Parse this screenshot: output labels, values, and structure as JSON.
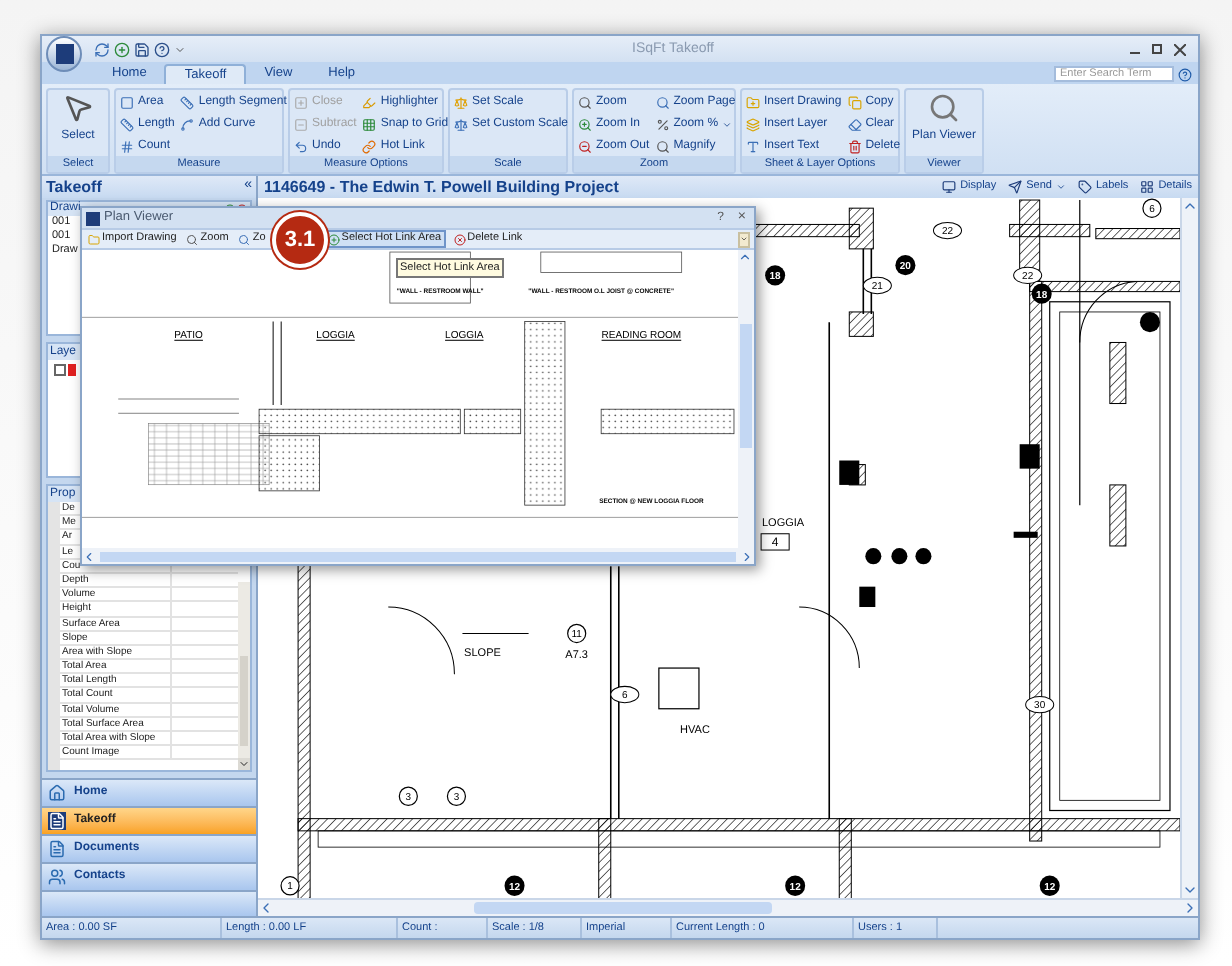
{
  "window": {
    "title": "ISqFt Takeoff"
  },
  "ribbon_tabs": [
    {
      "label": "Home",
      "selected": false
    },
    {
      "label": "Takeoff",
      "selected": true
    },
    {
      "label": "View",
      "selected": false
    },
    {
      "label": "Help",
      "selected": false
    }
  ],
  "search": {
    "placeholder": "Enter Search Term"
  },
  "ribbon_groups": [
    {
      "label": "Select",
      "kind": "large",
      "columns": [
        [
          {
            "label": "Select",
            "disabled": false
          }
        ]
      ]
    },
    {
      "label": "Measure",
      "kind": "small",
      "columns": [
        [
          {
            "label": "Area",
            "disabled": false
          },
          {
            "label": "Length",
            "disabled": false
          },
          {
            "label": "Count",
            "disabled": false
          }
        ],
        [
          {
            "label": "Length Segment",
            "disabled": false
          },
          {
            "label": "Add Curve",
            "disabled": false
          }
        ]
      ]
    },
    {
      "label": "Measure Options",
      "kind": "small",
      "columns": [
        [
          {
            "label": "Close",
            "disabled": true
          },
          {
            "label": "Subtract",
            "disabled": true
          },
          {
            "label": "Undo",
            "disabled": false
          }
        ],
        [
          {
            "label": "Highlighter",
            "disabled": false
          },
          {
            "label": "Snap to Grid",
            "disabled": false
          },
          {
            "label": "Hot Link",
            "disabled": false
          }
        ]
      ]
    },
    {
      "label": "Scale",
      "kind": "small",
      "columns": [
        [
          {
            "label": "Set Scale",
            "disabled": false
          },
          {
            "label": "Set Custom Scale",
            "disabled": false
          }
        ]
      ]
    },
    {
      "label": "Zoom",
      "kind": "small",
      "columns": [
        [
          {
            "label": "Zoom",
            "disabled": false
          },
          {
            "label": "Zoom In",
            "disabled": false
          },
          {
            "label": "Zoom Out",
            "disabled": false
          }
        ],
        [
          {
            "label": "Zoom Page",
            "disabled": false
          },
          {
            "label": "Zoom %",
            "disabled": false,
            "dropdown": true
          },
          {
            "label": "Magnify",
            "disabled": false
          }
        ]
      ]
    },
    {
      "label": "Sheet & Layer Options",
      "kind": "small",
      "columns": [
        [
          {
            "label": "Insert Drawing",
            "disabled": false
          },
          {
            "label": "Insert Layer",
            "disabled": false
          },
          {
            "label": "Insert Text",
            "disabled": false
          }
        ],
        [
          {
            "label": "Copy",
            "disabled": false
          },
          {
            "label": "Clear",
            "disabled": false
          },
          {
            "label": "Delete",
            "disabled": false
          }
        ]
      ]
    },
    {
      "label": "Viewer",
      "kind": "large",
      "columns": [
        [
          {
            "label": "Plan Viewer",
            "disabled": false
          }
        ]
      ]
    }
  ],
  "left_panel": {
    "title": "Takeoff",
    "collapse": "«",
    "drawings": {
      "title": "Drawi",
      "items": [
        "001",
        "001",
        "Draw"
      ]
    },
    "layers": {
      "title": "Laye",
      "items": [
        {
          "checked": false,
          "color": "#e02020"
        }
      ]
    },
    "properties": {
      "title": "Prop",
      "rows": [
        "De",
        "Me",
        "Ar",
        "Le",
        "Cou",
        "Depth",
        "Volume",
        "Height",
        "Surface Area",
        "Slope",
        "Area with Slope",
        "Total Area",
        "Total Length",
        "Total Count",
        "Total Volume",
        "Total Surface Area",
        "Total Area with Slope",
        "Count Image"
      ]
    },
    "nav": [
      {
        "label": "Home",
        "selected": false
      },
      {
        "label": "Takeoff",
        "selected": true
      },
      {
        "label": "Documents",
        "selected": false
      },
      {
        "label": "Contacts",
        "selected": false
      }
    ]
  },
  "sheet": {
    "title": "1146649 - The Edwin T. Powell Building Project",
    "toolbar": [
      {
        "label": "Display"
      },
      {
        "label": "Send",
        "dropdown": true
      },
      {
        "label": "Labels"
      },
      {
        "label": "Details"
      }
    ],
    "labels": [
      {
        "text": "18",
        "kind": "black-tag"
      },
      {
        "text": "20",
        "kind": "black-tag"
      },
      {
        "text": "21",
        "kind": "oval"
      },
      {
        "text": "22",
        "kind": "oval"
      },
      {
        "text": "22",
        "kind": "oval"
      },
      {
        "text": "18",
        "kind": "black-tag"
      },
      {
        "text": "6",
        "kind": "tag"
      },
      {
        "text": "LOGGIA",
        "kind": "text"
      },
      {
        "text": "4",
        "kind": "box"
      },
      {
        "text": "11",
        "kind": "tag"
      },
      {
        "text": "A7.3",
        "kind": "text"
      },
      {
        "text": "SLOPE",
        "kind": "text"
      },
      {
        "text": "6",
        "kind": "oval"
      },
      {
        "text": "HVAC",
        "kind": "text"
      },
      {
        "text": "3",
        "kind": "tag"
      },
      {
        "text": "3",
        "kind": "tag"
      },
      {
        "text": "1",
        "kind": "tag"
      },
      {
        "text": "12",
        "kind": "black-tag"
      },
      {
        "text": "12",
        "kind": "black-tag"
      },
      {
        "text": "12",
        "kind": "black-tag"
      },
      {
        "text": "30",
        "kind": "oval"
      }
    ]
  },
  "plan_viewer": {
    "title": "Plan Viewer",
    "help": "?",
    "close": "×",
    "toolbar": [
      {
        "label": "Import Drawing",
        "selected": false
      },
      {
        "label": "Zoom",
        "selected": false
      },
      {
        "label": "Zo",
        "selected": false
      },
      {
        "label": "Select Hot Link Area",
        "selected": true
      },
      {
        "label": "Delete Link",
        "selected": false
      }
    ],
    "step_badge": "3.1",
    "tooltip": "Select Hot Link Area",
    "drawing_labels": [
      "PATIO",
      "LOGGIA",
      "LOGGIA",
      "READING ROOM",
      "\"WALL - RESTROOM WALL\"",
      "\"WALL - RESTROOM O.L JOIST @ CONCRETE\"",
      "SECTION @ NEW LOGGIA FLOOR"
    ]
  },
  "status_bar": [
    "Area : 0.00 SF",
    "Length : 0.00 LF",
    "Count :",
    "Scale : 1/8",
    "Imperial",
    "Current Length : 0",
    "Users : 1"
  ]
}
